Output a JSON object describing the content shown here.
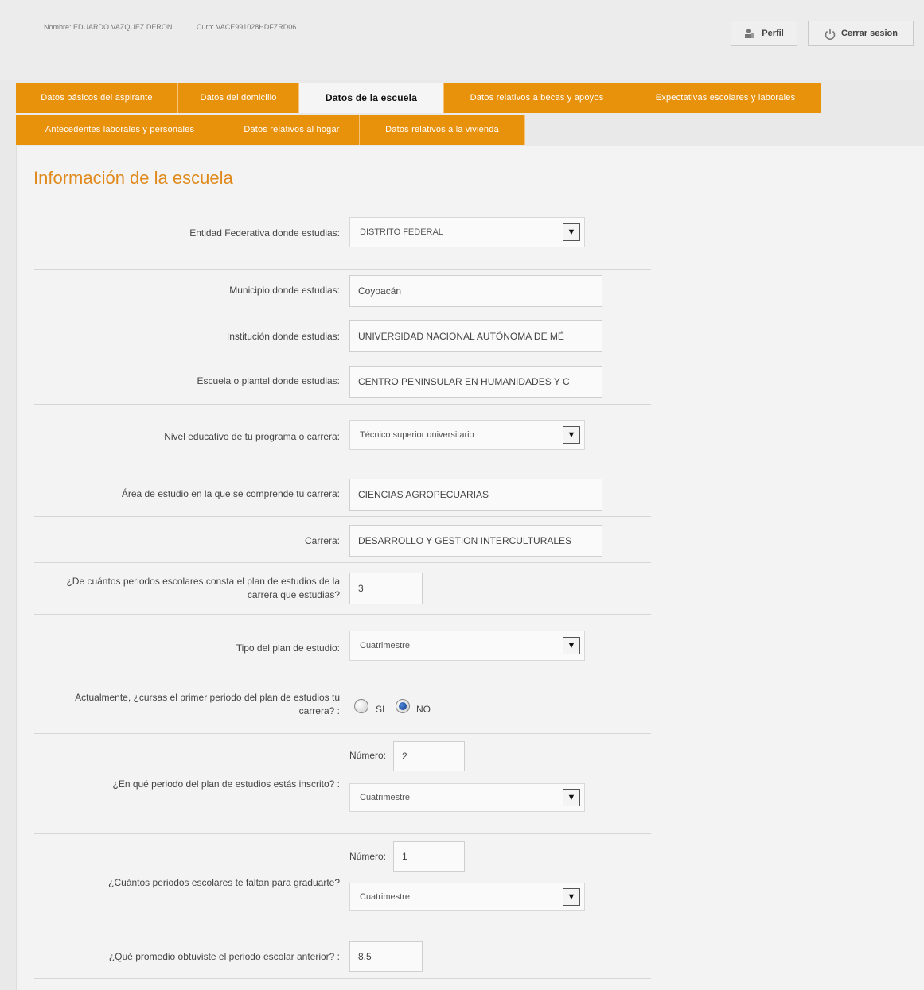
{
  "header": {
    "nombre": "Nombre: EDUARDO VAZQUEZ DERON",
    "curp": "Curp: VACE991028HDFZRD06",
    "perfil_label": "Perfil",
    "logout_label": "Cerrar sesion"
  },
  "tabs": [
    {
      "label": "Datos básicos del aspirante"
    },
    {
      "label": "Datos del domicilio"
    },
    {
      "label": "Datos de la escuela"
    },
    {
      "label": "Datos relativos a becas y apoyos"
    },
    {
      "label": "Expectativas escolares y laborales"
    },
    {
      "label": "Antecedentes laborales y personales"
    },
    {
      "label": "Datos relativos al hogar"
    },
    {
      "label": "Datos relativos a la vivienda"
    }
  ],
  "section_title": "Información de la escuela",
  "form": {
    "entidad_label": "Entidad Federativa donde estudias:",
    "entidad_value": "DISTRITO FEDERAL",
    "municipio_label": "Municipio donde estudias:",
    "municipio_value": "Coyoacán",
    "institucion_label": "Institución donde estudias:",
    "institucion_value": "UNIVERSIDAD NACIONAL AUTÓNOMA DE MÉ",
    "escuela_label": "Escuela o plantel donde estudias:",
    "escuela_value": "CENTRO PENINSULAR EN HUMANIDADES Y C",
    "nivel_label": "Nivel educativo de tu programa o carrera:",
    "nivel_value": "Técnico superior universitario",
    "area_label": "Área de estudio en la que se comprende tu carrera:",
    "area_value": "CIENCIAS AGROPECUARIAS",
    "carrera_label": "Carrera:",
    "carrera_value": "DESARROLLO Y GESTION INTERCULTURALES",
    "periodos_label_1": "¿De cuántos periodos escolares consta el plan de estudios de la",
    "periodos_label_2": "carrera que estudias?",
    "periodos_value": "3",
    "tipo_label": "Tipo del plan de estudio:",
    "tipo_value": "Cuatrimestre",
    "primer_label_1": "Actualmente, ¿cursas el primer periodo del plan de estudios tu",
    "primer_label_2": "carrera? :",
    "primer_si": "SI",
    "primer_no": "NO",
    "inscrito_label": "¿En qué periodo del plan de estudios estás inscrito? :",
    "inscrito_num_label": "Número:",
    "inscrito_num_value": "2",
    "inscrito_tipo_value": "Cuatrimestre",
    "faltan_label": "¿Cuántos periodos escolares te faltan para graduarte?",
    "faltan_num_label": "Número:",
    "faltan_num_value": "1",
    "faltan_tipo_value": "Cuatrimestre",
    "promedio_label": "¿Qué promedio obtuviste el periodo escolar anterior? :",
    "promedio_value": "8.5"
  },
  "colors": {
    "accent_orange": "#e8920c",
    "title_orange": "#e08a1c",
    "radio_selected": "#1f4ea8"
  },
  "icons": [
    "perfil-icon",
    "power-icon",
    "chevron-down-icon"
  ]
}
